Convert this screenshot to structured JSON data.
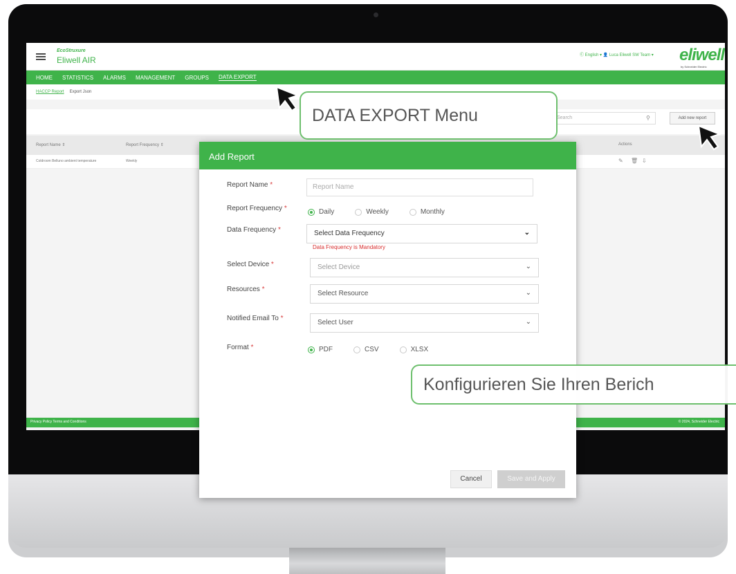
{
  "app": {
    "brand_small": "EcoStruxure",
    "brand_name": "Eliwell AIR",
    "top_right": "Ⓒ English ▾   👤 Luca Eliwell SW Team ▾",
    "logo": "eliwell",
    "logo_sub": "by Schneider Electric"
  },
  "nav": {
    "items": [
      "HOME",
      "STATISTICS",
      "ALARMS",
      "MANAGEMENT",
      "GROUPS",
      "DATA EXPORT"
    ],
    "active": "DATA EXPORT"
  },
  "subtabs": [
    "HACCP Report",
    "Export Json"
  ],
  "toolbar": {
    "search_placeholder": "Search",
    "add_new": "Add new report"
  },
  "table": {
    "headers": [
      "Report Name ⇕",
      "Report Frequency ⇕",
      "Actions"
    ],
    "rows": [
      {
        "name": "Coldroom Belluno ambient temperature",
        "frequency": "Weekly"
      }
    ]
  },
  "footer": {
    "left": "Privacy Policy  Terms and Conditions",
    "right": "© 2024, Schneider Electric"
  },
  "modal": {
    "title": "Add Report",
    "report_name": {
      "label": "Report Name",
      "placeholder": "Report Name"
    },
    "report_frequency": {
      "label": "Report Frequency",
      "options": [
        "Daily",
        "Weekly",
        "Monthly"
      ],
      "selected": "Daily"
    },
    "data_frequency": {
      "label": "Data Frequency",
      "value": "Select Data Frequency",
      "error": "Data Frequency is Mandatory"
    },
    "device": {
      "label": "Select Device",
      "value": "Select Device"
    },
    "resources": {
      "label": "Resources",
      "value": "Select Resource"
    },
    "email": {
      "label": "Notified Email To",
      "value": "Select User"
    },
    "format": {
      "label": "Format",
      "options": [
        "PDF",
        "CSV",
        "XLSX"
      ],
      "selected": "PDF"
    },
    "required_mark": "*",
    "cancel": "Cancel",
    "save": "Save and Apply"
  },
  "callouts": {
    "menu": "DATA EXPORT Menu",
    "configure": "Konfigurieren Sie Ihren Berich"
  },
  "colors": {
    "accent_green": "#3fb34a",
    "error_red": "#d82c2c",
    "callout_border": "#6dbf6d"
  }
}
